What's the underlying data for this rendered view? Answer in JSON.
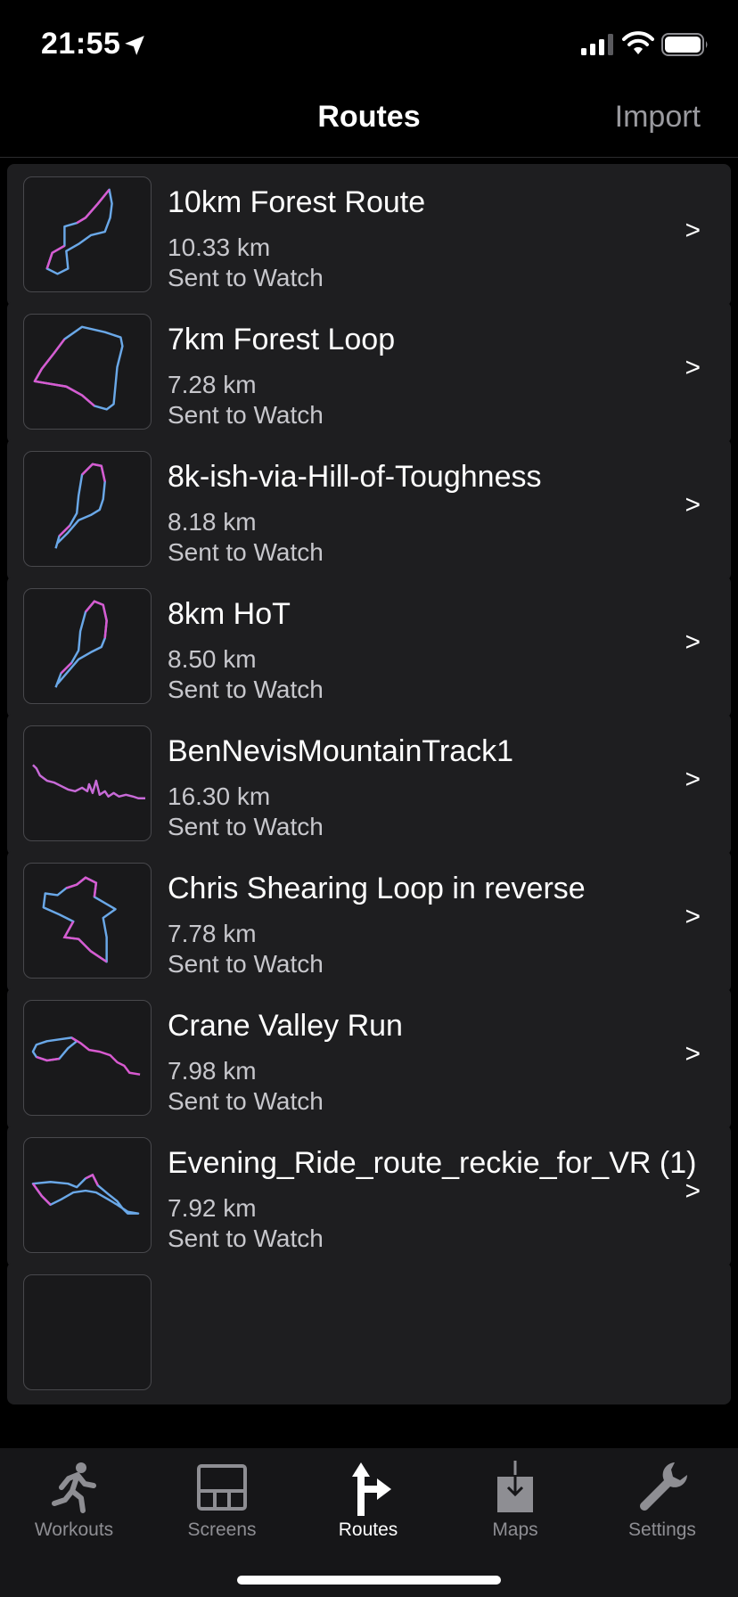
{
  "status_bar": {
    "time": "21:55"
  },
  "nav": {
    "title": "Routes",
    "import_label": "Import"
  },
  "routes": [
    {
      "name": "10km Forest Route",
      "distance": "10.33 km",
      "status": "Sent to Watch"
    },
    {
      "name": "7km Forest Loop",
      "distance": "7.28 km",
      "status": "Sent to Watch"
    },
    {
      "name": "8k-ish-via-Hill-of-Toughness",
      "distance": "8.18 km",
      "status": "Sent to Watch"
    },
    {
      "name": "8km HoT",
      "distance": "8.50 km",
      "status": "Sent to Watch"
    },
    {
      "name": "BenNevisMountainTrack1",
      "distance": "16.30 km",
      "status": "Sent to Watch"
    },
    {
      "name": "Chris Shearing Loop in reverse",
      "distance": "7.78 km",
      "status": "Sent to Watch"
    },
    {
      "name": "Crane Valley Run",
      "distance": "7.98 km",
      "status": "Sent to Watch"
    },
    {
      "name": "Evening_Ride_route_reckie_for_VR (1)",
      "distance": "7.92 km",
      "status": "Sent to Watch"
    }
  ],
  "chevron": ">",
  "tabs": [
    {
      "label": "Workouts",
      "icon": "runner-icon"
    },
    {
      "label": "Screens",
      "icon": "screens-grid-icon"
    },
    {
      "label": "Routes",
      "icon": "route-turn-icon",
      "active": true
    },
    {
      "label": "Maps",
      "icon": "map-download-icon"
    },
    {
      "label": "Settings",
      "icon": "wrench-icon"
    }
  ],
  "colors": {
    "background": "#000000",
    "card": "#1e1e20",
    "secondary_text": "#c7c7cc",
    "route_pink": "#d85ad0",
    "route_blue": "#6aa8e8"
  }
}
